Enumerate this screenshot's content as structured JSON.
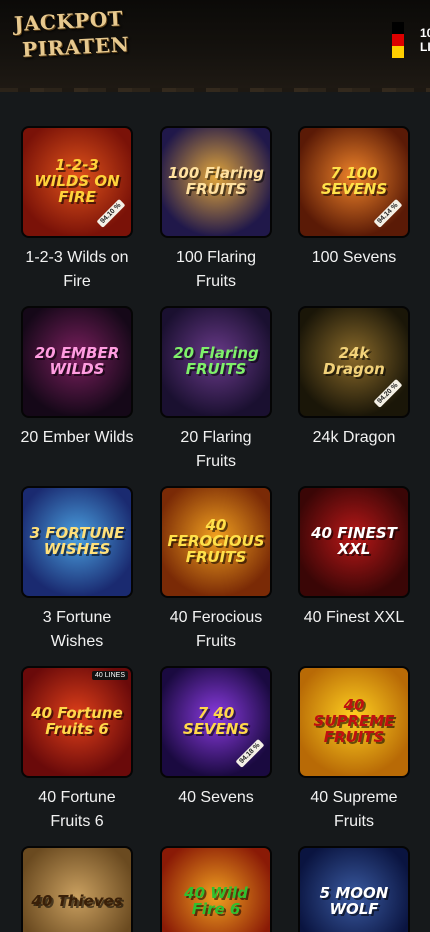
{
  "header": {
    "logo_line1": "JACKPOT",
    "logo_line2": "PIRATEN",
    "lang_code_1": "10",
    "lang_code_2": "LI",
    "flag_colors": [
      "#000000",
      "#dd0000",
      "#ffce00"
    ]
  },
  "games": [
    {
      "name": "1-2-3 Wilds on Fire",
      "art": "1-2-3 WILDS ON FIRE",
      "bg1": "#7a1208",
      "bg2": "#e0531b",
      "fg": "#ffd23a",
      "rtp": "94.10 %"
    },
    {
      "name": "100 Flaring Fruits",
      "art": "100 Flaring FRUITS",
      "bg1": "#20184a",
      "bg2": "#e2a63c",
      "fg": "#ffe1a0",
      "rtp": ""
    },
    {
      "name": "100 Sevens",
      "art": "7 100 SEVENS",
      "bg1": "#5a1a06",
      "bg2": "#f0842a",
      "fg": "#ffe24a",
      "rtp": "94.14 %"
    },
    {
      "name": "20 Ember Wilds",
      "art": "20 EMBER WILDS",
      "bg1": "#150818",
      "bg2": "#7a1f5e",
      "fg": "#ff9de0",
      "rtp": ""
    },
    {
      "name": "20 Flaring Fruits",
      "art": "20 Flaring FRUITS",
      "bg1": "#1a1030",
      "bg2": "#6a3a8a",
      "fg": "#7ff06a",
      "rtp": ""
    },
    {
      "name": "24k Dragon",
      "art": "24k Dragon",
      "bg1": "#1a1608",
      "bg2": "#8a6a2a",
      "fg": "#f2d27a",
      "rtp": "94.20 %"
    },
    {
      "name": "3 Fortune Wishes",
      "art": "3 FORTUNE WISHES",
      "bg1": "#1a2a70",
      "bg2": "#4aa0e0",
      "fg": "#ffe07a",
      "rtp": ""
    },
    {
      "name": "40 Ferocious Fruits",
      "art": "40 FEROCIOUS FRUITS",
      "bg1": "#7a2a06",
      "bg2": "#f0a020",
      "fg": "#ffe14a",
      "rtp": ""
    },
    {
      "name": "40 Finest XXL",
      "art": "40 FINEST XXL",
      "bg1": "#3a0606",
      "bg2": "#b81818",
      "fg": "#ffffff",
      "rtp": ""
    },
    {
      "name": "40 Fortune Fruits 6",
      "art": "40 Fortune Fruits 6",
      "bg1": "#6a0a0a",
      "bg2": "#e0401a",
      "fg": "#ffd84a",
      "rtp": "",
      "tag": "40 LINES"
    },
    {
      "name": "40 Sevens",
      "art": "7 40 SEVENS",
      "bg1": "#1a0a40",
      "bg2": "#8a3ae0",
      "fg": "#ffd84a",
      "rtp": "94.18 %"
    },
    {
      "name": "40 Supreme Fruits",
      "art": "40 SUPREME FRUITS",
      "bg1": "#b86a06",
      "bg2": "#ffd020",
      "fg": "#c01010",
      "rtp": ""
    },
    {
      "name": "",
      "art": "40 Thieves",
      "bg1": "#6a4a20",
      "bg2": "#caa060",
      "fg": "#3a2008",
      "rtp": ""
    },
    {
      "name": "",
      "art": "40 Wild Fire 6",
      "bg1": "#8a1a06",
      "bg2": "#f0a020",
      "fg": "#30c030",
      "rtp": ""
    },
    {
      "name": "",
      "art": "5 MOON WOLF",
      "bg1": "#0a1440",
      "bg2": "#3a5aa0",
      "fg": "#ffffff",
      "rtp": ""
    }
  ]
}
